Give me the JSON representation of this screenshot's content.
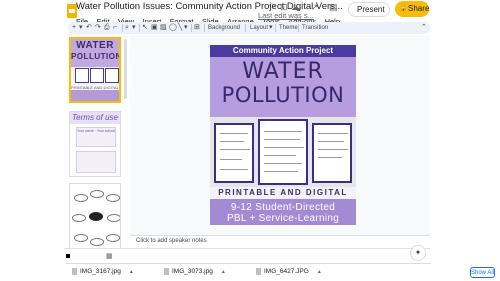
{
  "header": {
    "doc_title": "Water Pollution Issues: Community Action Project Digital Vers...",
    "present_label": "Present",
    "share_label": "Share"
  },
  "menu": {
    "items": [
      "File",
      "Edit",
      "View",
      "Insert",
      "Format",
      "Slide",
      "Arrange",
      "Tools",
      "Add-ons",
      "Help"
    ],
    "last_edit": "Last edit was s..."
  },
  "toolbar": {
    "background_label": "Background",
    "layout_label": "Layout",
    "theme_label": "Theme",
    "transition_label": "Transition"
  },
  "filmstrip": {
    "slide1": {
      "title_line1": "WATER",
      "title_line2": "POLLUTION",
      "band_text": "PRINTABLE AND DIGITAL"
    },
    "slide2": {
      "title": "Terms of use",
      "label": "Your name · Your school"
    }
  },
  "slide": {
    "banner": "Community Action Project",
    "title_line1": "WATER",
    "title_line2": "POLLUTION",
    "printable": "PRINTABLE AND DIGITAL",
    "grades_line1": "9-12 Student-Directed",
    "grades_line2": "PBL + Service-Learning",
    "colors": {
      "banner": "#4b3aa0",
      "lavender": "#b59ddf",
      "title": "#35286e"
    }
  },
  "notes": {
    "placeholder": "Click to add speaker notes"
  },
  "downloads": {
    "files": [
      "IMG_3167.jpg",
      "IMG_3073.jpg",
      "IMG_6427.JPG"
    ],
    "show_all": "Show All"
  }
}
